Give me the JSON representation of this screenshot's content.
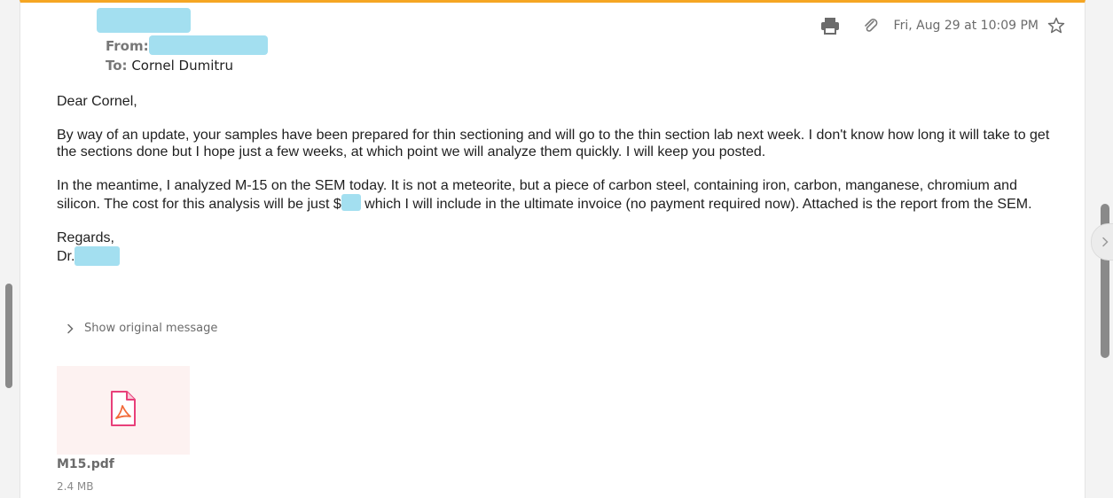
{
  "header": {
    "from_label": "From:",
    "to_label": "To:",
    "to_value": "Cornel Dumitru",
    "date": "Fri, Aug 29 at 10:09 PM",
    "icons": [
      "print-icon",
      "paperclip-icon",
      "star-icon"
    ],
    "accent_color": "#f5a623"
  },
  "body": {
    "greeting": "Dear Cornel,",
    "paragraph1": "By way of an update, your samples have been prepared for thin sectioning and will go to the thin section lab next week. I don't know how long it will take to get the sections done but I hope just a few weeks, at which point we will analyze them quickly. I will keep you posted.",
    "paragraph2_before": "In the meantime, I analyzed M-15 on the SEM today. It is not a meteorite, but a piece of carbon steel, containing iron, carbon, manganese, chromium and silicon. The cost for this analysis will be just $",
    "paragraph2_after": " which I will include in the ultimate invoice (no payment required now). Attached is the report from the SEM.",
    "closing": "Regards,",
    "signature_prefix": "Dr."
  },
  "show_original": {
    "label": "Show original message"
  },
  "attachment": {
    "file_name": "M15.pdf",
    "file_size": "2.4 MB",
    "icon": "pdf-file-icon"
  },
  "redaction_color": "#a3dff0"
}
